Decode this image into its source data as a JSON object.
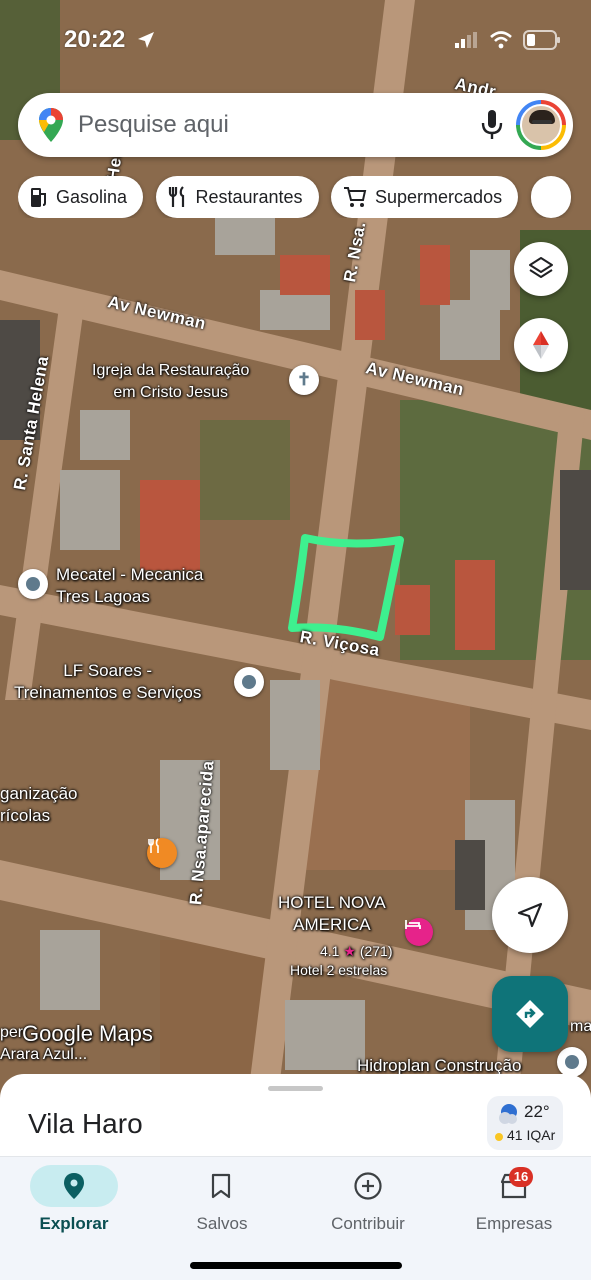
{
  "status_bar": {
    "time": "20:22"
  },
  "search": {
    "placeholder": "Pesquise aqui"
  },
  "chips": [
    {
      "label": "Gasolina",
      "icon": "gas-station-icon"
    },
    {
      "label": "Restaurantes",
      "icon": "fork-knife-icon"
    },
    {
      "label": "Supermercados",
      "icon": "shopping-cart-icon"
    }
  ],
  "map": {
    "streets": {
      "av_newman_1": "Av Newman",
      "av_newman_2": "Av Newman",
      "santa_helena": "R. Santa Helena",
      "nsa_top": "R. Nsa.",
      "vicosa": "R. Viçosa",
      "nsa_aparecida": "R. Nsa.aparecida",
      "top_fragment": "Andr",
      "helena_top": "Helena"
    },
    "places": {
      "igreja": "Igreja da Restauração\nem Cristo Jesus",
      "mecatel": "Mecatel - Mecanica\nTres Lagoas",
      "lf_soares": "LF Soares -\nTreinamentos e Serviços",
      "organizacao": "ganização\nrícolas",
      "hotel_name": "HOTEL NOVA\nAMERICA",
      "hotel_rating": "4.1",
      "hotel_reviews": "(271)",
      "hotel_class": "Hotel 2 estrelas",
      "hidroplan": "Hidroplan Construção",
      "super_arara": "per\nArara Azul...",
      "edge_fragment": "ma"
    },
    "watermark": "Google Maps",
    "highlight_color": "#3ef08f"
  },
  "sheet": {
    "place_name": "Vila Haro",
    "weather_temp": "22°",
    "air_quality": "41 IQAr"
  },
  "bottom_nav": [
    {
      "label": "Explorar",
      "icon": "pin-icon",
      "active": true
    },
    {
      "label": "Salvos",
      "icon": "bookmark-icon",
      "active": false
    },
    {
      "label": "Contribuir",
      "icon": "plus-circle-icon",
      "active": false
    },
    {
      "label": "Empresas",
      "icon": "store-icon",
      "active": false,
      "badge": "16"
    }
  ],
  "colors": {
    "accent": "#0b6b6e",
    "directions_fab": "#0f7479",
    "explore_pill": "#c8ecf0",
    "badge": "#d93025",
    "hotel_pin": "#e6238a"
  }
}
